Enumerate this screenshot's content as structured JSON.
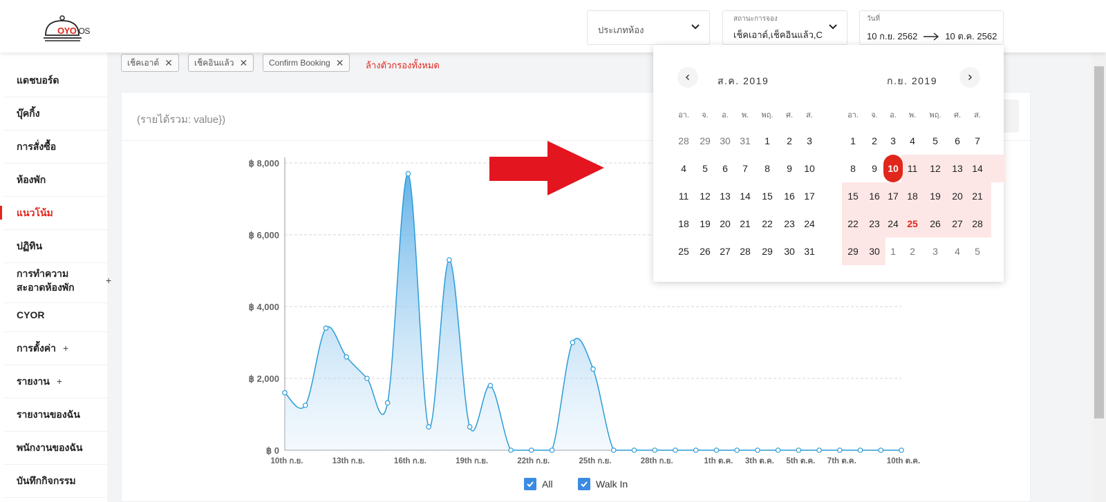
{
  "brand": {
    "mark": "OYO",
    "suffix": "OS"
  },
  "header": {
    "room_type": {
      "label": "ประเภทห้อง"
    },
    "booking_status": {
      "label": "สถานะการจอง",
      "value": "เช็คเอาต์,เช็คอินแล้ว,C"
    },
    "date": {
      "label": "วันที่",
      "start": "10 ก.ย. 2562",
      "end": "10 ต.ค. 2562"
    }
  },
  "sidebar": {
    "items": [
      {
        "label": "แดชบอร์ด"
      },
      {
        "label": "บุ๊คกิ้ง"
      },
      {
        "label": "การสั่งซื้อ"
      },
      {
        "label": "ห้องพัก"
      },
      {
        "label": "แนวโน้ม",
        "active": true
      },
      {
        "label": "ปฏิทิน"
      },
      {
        "label": "การทำความ",
        "label2": "สะอาดห้องพัก",
        "plus": "+"
      },
      {
        "label": "CYOR"
      },
      {
        "label": "การตั้งค่า",
        "plus": "+"
      },
      {
        "label": "รายงาน",
        "plus": "+"
      },
      {
        "label": "รายงานของฉัน"
      },
      {
        "label": "พนักงานของฉัน"
      },
      {
        "label": "บันทึกกิจกรรม"
      }
    ]
  },
  "filters": {
    "chips": [
      "เช็คเอาต์",
      "เช็คอินแล้ว",
      "Confirm Booking"
    ],
    "clear_all": "ล้างตัวกรองทั้งหมด"
  },
  "card": {
    "title": "(รายได้รวม: value})"
  },
  "legend": {
    "all": "All",
    "walk_in": "Walk In"
  },
  "calendar": {
    "left_month": "ส.ค. 2019",
    "right_month": "ก.ย. 2019",
    "weekdays": [
      "อา.",
      "จ.",
      "อ.",
      "พ.",
      "พฤ.",
      "ศ.",
      "ส."
    ],
    "selected_day": "10",
    "highlight_day": "25"
  },
  "chart_data": {
    "type": "area",
    "y_tick_labels": [
      "฿ 0",
      "฿ 2,000",
      "฿ 4,000",
      "฿ 6,000",
      "฿ 8,000"
    ],
    "y_ticks": [
      0,
      2000,
      4000,
      6000,
      8000
    ],
    "ylim": [
      0,
      8000
    ],
    "x_tick_labels": [
      "10th ก.ย.",
      "13th ก.ย.",
      "16th ก.ย.",
      "19th ก.ย.",
      "22th ก.ย.",
      "25th ก.ย.",
      "28th ก.ย.",
      "1th ต.ค.",
      "3th ต.ค.",
      "5th ต.ค.",
      "7th ต.ค.",
      "10th ต.ค."
    ],
    "x_tick_index": [
      0,
      3,
      6,
      9,
      12,
      15,
      18,
      21,
      23,
      25,
      27,
      30
    ],
    "series": [
      {
        "values": [
          1600,
          1250,
          3400,
          2600,
          2000,
          1320,
          7700,
          650,
          5300,
          650,
          1800,
          0,
          0,
          0,
          3000,
          2260,
          0,
          0,
          0,
          0,
          0,
          0,
          0,
          0,
          0,
          0,
          0,
          0,
          0,
          0,
          0
        ],
        "color": "#2b9bd7"
      }
    ]
  },
  "arrow_color": "#e3151f"
}
